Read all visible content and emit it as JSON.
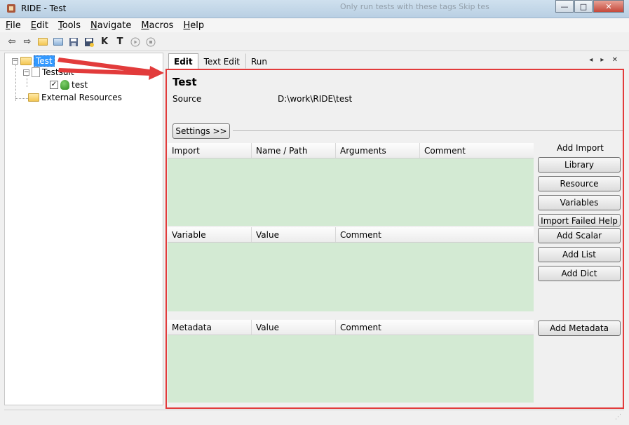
{
  "window": {
    "title": "RIDE - Test",
    "bg_hint": "Only run tests with these tags      Skip tes"
  },
  "window_controls": {
    "minimize": "—",
    "maximize": "□",
    "close": "✕"
  },
  "menu": [
    "File",
    "Edit",
    "Tools",
    "Navigate",
    "Macros",
    "Help"
  ],
  "toolbar": {
    "icons": [
      "back-icon",
      "forward-icon",
      "open-suite-icon",
      "open-dir-icon",
      "save-icon",
      "save-all-icon",
      "search-keywords-icon",
      "search-tests-icon",
      "run-icon",
      "stop-icon"
    ],
    "glyphs": [
      "⇦",
      "⇨",
      "📂",
      "📁",
      "💾",
      "🖫",
      "K",
      "T",
      "▶",
      "■"
    ]
  },
  "tree": {
    "root": "Test",
    "suite": "Testsuit",
    "test": "test",
    "external": "External Resources"
  },
  "tabs": [
    "Edit",
    "Text Edit",
    "Run"
  ],
  "tab_nav": "◂ ▸ ✕",
  "editor": {
    "title": "Test",
    "source_label": "Source",
    "source_value": "D:\\work\\RIDE\\test",
    "settings_button": "Settings >>",
    "import_table": {
      "headers": [
        "Import",
        "Name / Path",
        "Arguments",
        "Comment"
      ]
    },
    "variable_table": {
      "headers": [
        "Variable",
        "Value",
        "Comment"
      ]
    },
    "metadata_table": {
      "headers": [
        "Metadata",
        "Value",
        "Comment"
      ]
    },
    "add_import_label": "Add Import",
    "buttons": {
      "library": "Library",
      "resource": "Resource",
      "variables": "Variables",
      "import_failed_help": "Import Failed Help",
      "add_scalar": "Add Scalar",
      "add_list": "Add List",
      "add_dict": "Add Dict",
      "add_metadata": "Add Metadata"
    }
  },
  "colors": {
    "highlight_border": "#e23b3b",
    "table_body": "#d3ead3",
    "selection": "#3399ff"
  }
}
